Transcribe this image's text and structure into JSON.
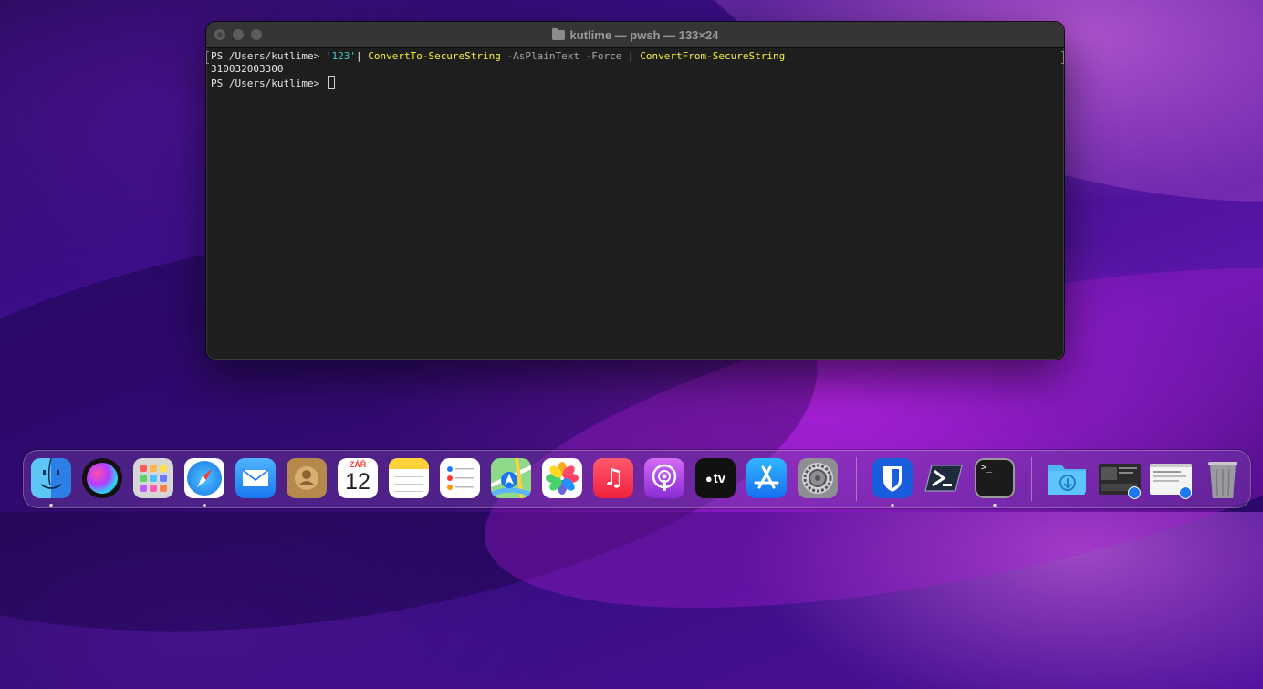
{
  "window": {
    "title": "kutlime — pwsh — 133×24"
  },
  "terminal": {
    "prompt1": "PS /Users/kutlime> ",
    "str_arg": "'123'",
    "pipe1": "| ",
    "cmd1": "ConvertTo-SecureString",
    "param1": " -AsPlainText -Force",
    "pipe2": " | ",
    "cmd2": "ConvertFrom-SecureString",
    "output": "310032003300",
    "prompt2": "PS /Users/kutlime> "
  },
  "dock": {
    "calendar_month": "ZÁŘ",
    "calendar_day": "12",
    "apps": [
      {
        "name": "Finder",
        "icon": "finder-icon"
      },
      {
        "name": "Siri",
        "icon": "siri-icon"
      },
      {
        "name": "Launchpad",
        "icon": "launchpad-icon"
      },
      {
        "name": "Safari",
        "icon": "safari-icon"
      },
      {
        "name": "Mail",
        "icon": "mail-icon"
      },
      {
        "name": "Contacts",
        "icon": "contacts-icon"
      },
      {
        "name": "Calendar",
        "icon": "calendar-icon"
      },
      {
        "name": "Notes",
        "icon": "notes-icon"
      },
      {
        "name": "Reminders",
        "icon": "reminders-icon"
      },
      {
        "name": "Maps",
        "icon": "maps-icon"
      },
      {
        "name": "Photos",
        "icon": "photos-icon"
      },
      {
        "name": "Music",
        "icon": "music-icon"
      },
      {
        "name": "Podcasts",
        "icon": "podcasts-icon"
      },
      {
        "name": "TV",
        "icon": "apple-tv-icon"
      },
      {
        "name": "App Store",
        "icon": "app-store-icon"
      },
      {
        "name": "System Preferences",
        "icon": "system-preferences-icon"
      },
      {
        "name": "Bitwarden",
        "icon": "bitwarden-icon"
      },
      {
        "name": "PowerShell",
        "icon": "powershell-icon"
      },
      {
        "name": "Terminal",
        "icon": "terminal-icon"
      },
      {
        "name": "Downloads",
        "icon": "downloads-folder-icon"
      },
      {
        "name": "Recent item",
        "icon": "screenshot-thumbnail-icon"
      },
      {
        "name": "Recent item",
        "icon": "document-thumbnail-icon"
      },
      {
        "name": "Trash",
        "icon": "trash-icon"
      }
    ],
    "tv_label": "tv"
  }
}
